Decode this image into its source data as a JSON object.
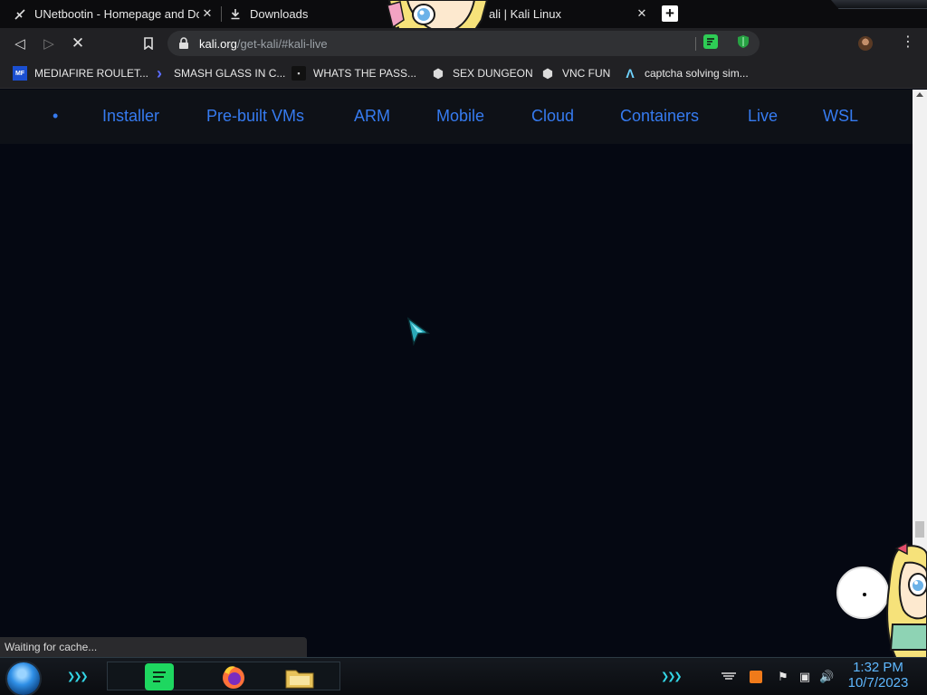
{
  "tabs": [
    {
      "title": "UNetbootin - Homepage and Dow",
      "icon": "unetbootin-icon"
    },
    {
      "title": "Downloads",
      "icon": "download-icon"
    },
    {
      "title": "ali | Kali Linux",
      "icon": "kali-icon"
    }
  ],
  "new_tab_label": "+",
  "close_glyph": "✕",
  "toolbar": {
    "back": "◁",
    "forward": "▷",
    "stop": "✕",
    "url_host": "kali.org",
    "url_path": "/get-kali/#kali-live",
    "menu": "⋮"
  },
  "bookmarks": [
    {
      "label": "MEDIAFIRE ROULET...",
      "icon": "mediafire-icon",
      "glyph": "MF"
    },
    {
      "label": "SMASH GLASS IN C...",
      "icon": "chevron-bookmark-icon",
      "glyph": "›"
    },
    {
      "label": "WHATS THE PASS...",
      "icon": "lock-bookmark-icon",
      "glyph": "▪"
    },
    {
      "label": "SEX DUNGEON",
      "icon": "cube-icon",
      "glyph": "⬢"
    },
    {
      "label": "VNC FUN",
      "icon": "cube-icon",
      "glyph": "⬢"
    },
    {
      "label": "captcha solving sim...",
      "icon": "lambda-icon",
      "glyph": "Λ"
    }
  ],
  "kali_nav": {
    "dot": "•",
    "items": [
      "Installer",
      "Pre-built VMs",
      "ARM",
      "Mobile",
      "Cloud",
      "Containers",
      "Live",
      "WSL"
    ]
  },
  "status_text": "Waiting for cache...",
  "taskbar": {
    "chevrons": "❯❯❯",
    "time": "1:32 PM",
    "date": "10/7/2023",
    "tray": [
      "ʌ",
      "▲",
      "⚑",
      "▣",
      "🔊"
    ]
  },
  "colors": {
    "kali_link": "#367bf0",
    "page_bg": "#050812",
    "clock": "#5fb8ff",
    "accent_cyan": "#34d6e6"
  }
}
